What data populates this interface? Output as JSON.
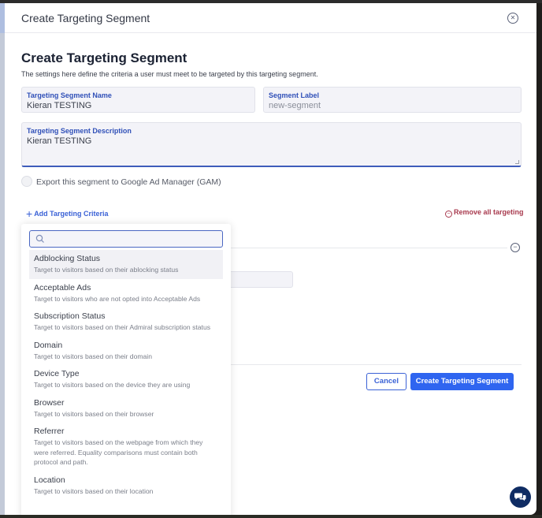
{
  "window": {
    "title": "Create Targeting Segment",
    "close_icon": "close-circle-icon"
  },
  "page": {
    "title": "Create Targeting Segment",
    "subtitle": "The settings here define the criteria a user must meet to be targeted by this targeting segment."
  },
  "form": {
    "name": {
      "label": "Targeting Segment Name",
      "value": "Kieran TESTING"
    },
    "segment_label": {
      "label": "Segment Label",
      "placeholder": "new-segment"
    },
    "description": {
      "label": "Targeting Segment Description",
      "value": "Kieran TESTING"
    },
    "gam_export": {
      "label": "Export this segment to Google Ad Manager (GAM)",
      "checked": false
    }
  },
  "targeting": {
    "add_label": "Add Targeting Criteria",
    "add_icon": "plus-icon",
    "remove_all_label": "Remove all targeting",
    "remove_icon": "minus-circle-icon"
  },
  "dropdown": {
    "search_placeholder": "",
    "search_icon": "search-icon",
    "items": [
      {
        "title": "Adblocking Status",
        "desc": "Target to visitors based on their ablocking status",
        "active": true
      },
      {
        "title": "Acceptable Ads",
        "desc": "Target to visitors who are not opted into Acceptable Ads"
      },
      {
        "title": "Subscription Status",
        "desc": "Target to visitors based on their Admiral subscription status"
      },
      {
        "title": "Domain",
        "desc": "Target to visitors based on their domain"
      },
      {
        "title": "Device Type",
        "desc": "Target to visitors based on the device they are using"
      },
      {
        "title": "Browser",
        "desc": "Target to visitors based on their browser"
      },
      {
        "title": "Referrer",
        "desc": "Target to visitors based on the webpage from which they were referred. Equality comparisons must contain both protocol and path."
      },
      {
        "title": "Location",
        "desc": "Target to visitors based on their location"
      }
    ]
  },
  "footer": {
    "cancel_label": "Cancel",
    "create_label": "Create Targeting Segment"
  },
  "chat": {
    "icon": "chat-bubbles-icon"
  },
  "colors": {
    "primary": "#2f65f0",
    "label_blue": "#3050b8",
    "danger": "#a83a4e",
    "chat_bg": "#0f2c63"
  }
}
